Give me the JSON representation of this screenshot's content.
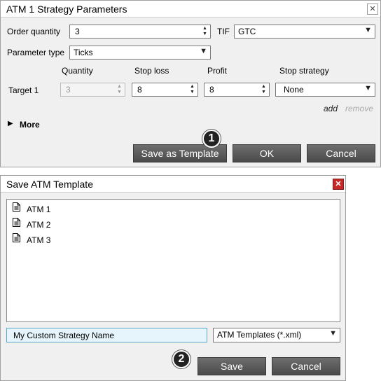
{
  "dialog1": {
    "title": "ATM 1 Strategy Parameters",
    "close_glyph": "✕",
    "order_quantity_label": "Order quantity",
    "order_quantity_value": "3",
    "tif_label": "TIF",
    "tif_value": "GTC",
    "parameter_type_label": "Parameter type",
    "parameter_type_value": "Ticks",
    "columns": [
      "Quantity",
      "Stop loss",
      "Profit",
      "Stop strategy"
    ],
    "target": {
      "label": "Target 1",
      "quantity": "3",
      "stop_loss": "8",
      "profit": "8",
      "stop_strategy": "None"
    },
    "add_link": "add",
    "remove_link": "remove",
    "more_label": "More",
    "buttons": {
      "save_template": "Save as Template",
      "ok": "OK",
      "cancel": "Cancel"
    },
    "badge": "1"
  },
  "dialog2": {
    "title": "Save ATM Template",
    "close_glyph": "✕",
    "templates": [
      "ATM 1",
      "ATM 2",
      "ATM 3"
    ],
    "name_input_value": "My Custom Strategy Name",
    "file_type_value": "ATM Templates (*.xml)",
    "buttons": {
      "save": "Save",
      "cancel": "Cancel"
    },
    "badge": "2"
  },
  "colors": {
    "dialog_bg": "#f0f0f0",
    "button_bg": "#555555",
    "close_red": "#c62828",
    "input_highlight": "#e6f5fb"
  }
}
